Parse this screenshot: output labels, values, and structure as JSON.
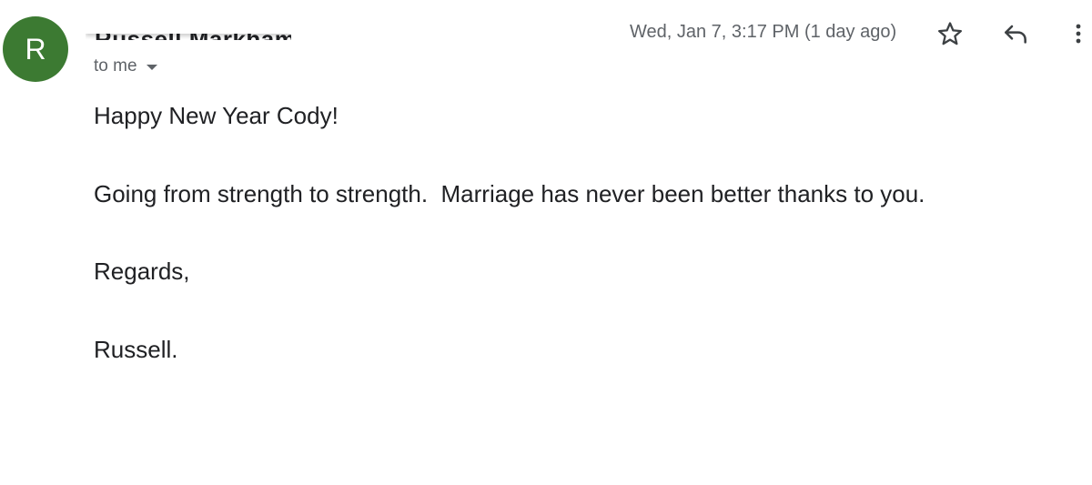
{
  "sender": {
    "avatar_initial": "R",
    "avatar_color": "#3c7a32",
    "name": "Russell Markham"
  },
  "recipient": {
    "label": "to me"
  },
  "date": {
    "text": "Wed, Jan 7, 3:17 PM (1 day ago)"
  },
  "actions": {
    "star_icon": "star-outline-icon",
    "reply_icon": "reply-arrow-icon",
    "more_icon": "vertical-dots-icon"
  },
  "body": {
    "lines": [
      "Happy New Year Cody!",
      "Going from strength to strength.  Marriage has never been better thanks to you.",
      "Regards,",
      "Russell."
    ]
  }
}
